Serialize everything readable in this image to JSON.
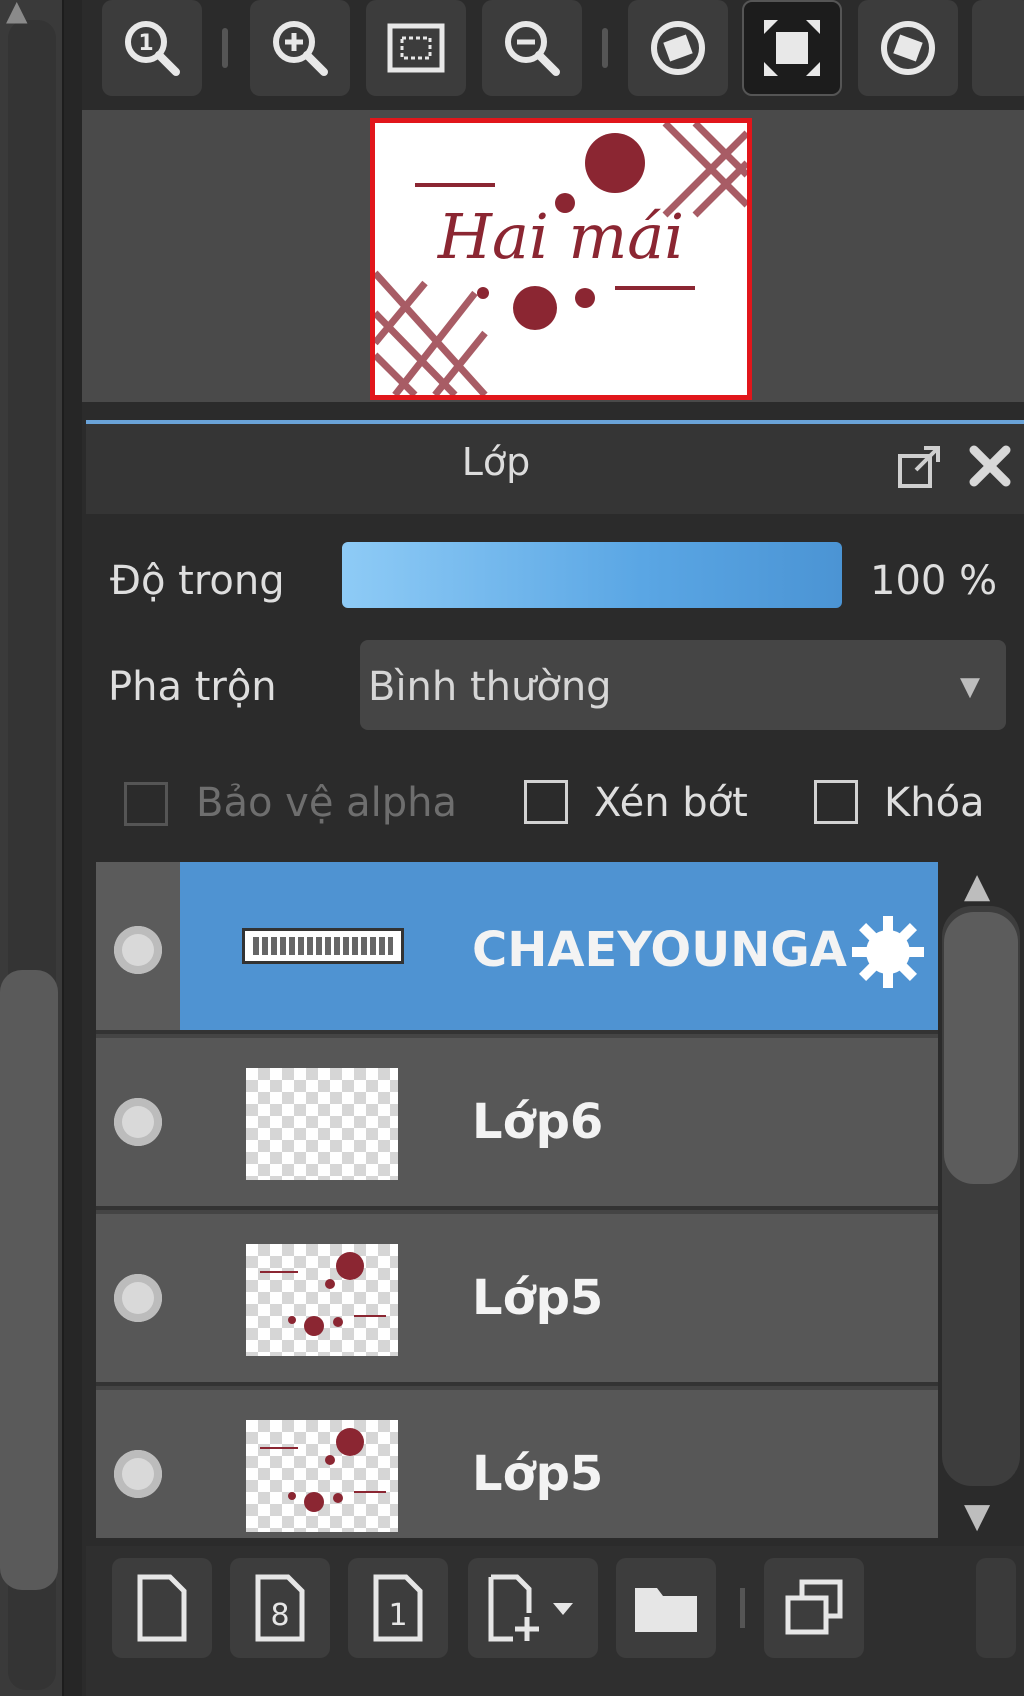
{
  "navigator": {
    "toolbar": [
      {
        "name": "zoom-actual-icon"
      },
      {
        "name": "zoom-in-icon"
      },
      {
        "name": "fit-screen-icon"
      },
      {
        "name": "zoom-out-icon"
      },
      {
        "name": "rotate-left-icon"
      },
      {
        "name": "fullscreen-icon",
        "active": true
      },
      {
        "name": "rotate-right-icon"
      }
    ],
    "thumbnail_text": "Hai mái"
  },
  "layer_panel": {
    "title": "Lớp",
    "opacity_label": "Độ trong",
    "opacity_value": "100 %",
    "opacity_fraction": 1.0,
    "blend_label": "Pha trộn",
    "blend_value": "Bình thường",
    "protect_alpha_label": "Bảo vệ alpha",
    "clipping_label": "Xén bớt",
    "lock_label": "Khóa",
    "layers": [
      {
        "name": "CHAEYOUNGA",
        "selected": true
      },
      {
        "name": "Lớp6",
        "selected": false
      },
      {
        "name": "Lớp5",
        "selected": false
      },
      {
        "name": "Lớp5",
        "selected": false
      }
    ]
  },
  "colors": {
    "accent": "#4f93d2",
    "thumbnail_border": "#e1161b",
    "artwork": "#8b2632"
  }
}
